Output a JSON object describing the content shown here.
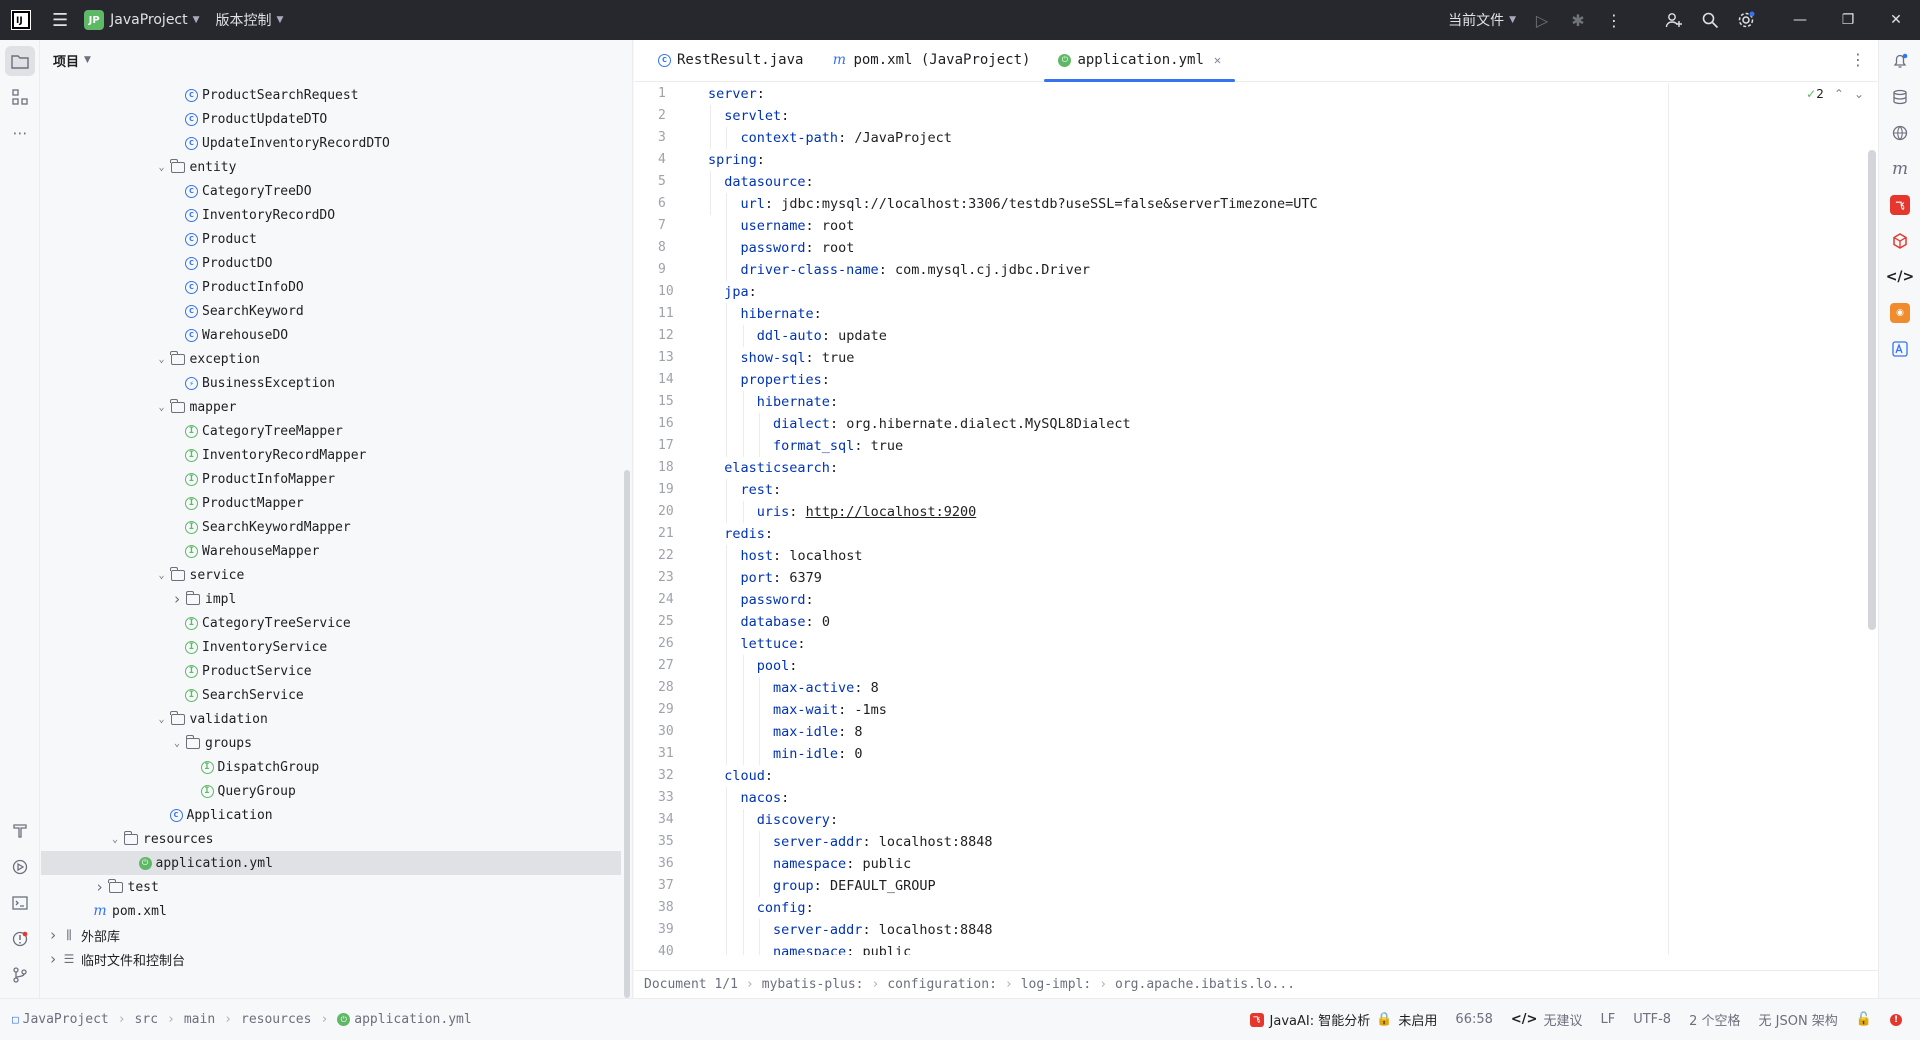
{
  "titlebar": {
    "project_badge": "JP",
    "project_name": "JavaProject",
    "vcs_label": "版本控制",
    "run_config": "当前文件"
  },
  "project_panel": {
    "title": "项目",
    "tree": [
      {
        "label": "ProductSearchRequest",
        "icon": "class-icon",
        "depth": 8,
        "chevron": ""
      },
      {
        "label": "ProductUpdateDTO",
        "icon": "class-icon",
        "depth": 8,
        "chevron": ""
      },
      {
        "label": "UpdateInventoryRecordDTO",
        "icon": "class-icon",
        "depth": 8,
        "chevron": ""
      },
      {
        "label": "entity",
        "icon": "folder-icon",
        "depth": 7,
        "chevron": "open"
      },
      {
        "label": "CategoryTreeDO",
        "icon": "class-icon",
        "depth": 8,
        "chevron": ""
      },
      {
        "label": "InventoryRecordDO",
        "icon": "class-icon",
        "depth": 8,
        "chevron": ""
      },
      {
        "label": "Product",
        "icon": "class-icon",
        "depth": 8,
        "chevron": ""
      },
      {
        "label": "ProductDO",
        "icon": "class-icon",
        "depth": 8,
        "chevron": ""
      },
      {
        "label": "ProductInfoDO",
        "icon": "class-icon",
        "depth": 8,
        "chevron": ""
      },
      {
        "label": "SearchKeyword",
        "icon": "class-icon",
        "depth": 8,
        "chevron": ""
      },
      {
        "label": "WarehouseDO",
        "icon": "class-icon",
        "depth": 8,
        "chevron": ""
      },
      {
        "label": "exception",
        "icon": "folder-icon",
        "depth": 7,
        "chevron": "open"
      },
      {
        "label": "BusinessException",
        "icon": "exception-class-icon",
        "depth": 8,
        "chevron": ""
      },
      {
        "label": "mapper",
        "icon": "folder-icon",
        "depth": 7,
        "chevron": "open"
      },
      {
        "label": "CategoryTreeMapper",
        "icon": "interface-icon",
        "depth": 8,
        "chevron": ""
      },
      {
        "label": "InventoryRecordMapper",
        "icon": "interface-icon",
        "depth": 8,
        "chevron": ""
      },
      {
        "label": "ProductInfoMapper",
        "icon": "interface-icon",
        "depth": 8,
        "chevron": ""
      },
      {
        "label": "ProductMapper",
        "icon": "interface-icon",
        "depth": 8,
        "chevron": ""
      },
      {
        "label": "SearchKeywordMapper",
        "icon": "interface-icon",
        "depth": 8,
        "chevron": ""
      },
      {
        "label": "WarehouseMapper",
        "icon": "interface-icon",
        "depth": 8,
        "chevron": ""
      },
      {
        "label": "service",
        "icon": "folder-icon",
        "depth": 7,
        "chevron": "open"
      },
      {
        "label": "impl",
        "icon": "folder-icon",
        "depth": 8,
        "chevron": "closed"
      },
      {
        "label": "CategoryTreeService",
        "icon": "interface-icon",
        "depth": 8,
        "chevron": ""
      },
      {
        "label": "InventoryService",
        "icon": "interface-icon",
        "depth": 8,
        "chevron": ""
      },
      {
        "label": "ProductService",
        "icon": "interface-icon",
        "depth": 8,
        "chevron": ""
      },
      {
        "label": "SearchService",
        "icon": "interface-icon",
        "depth": 8,
        "chevron": ""
      },
      {
        "label": "validation",
        "icon": "folder-icon",
        "depth": 7,
        "chevron": "open"
      },
      {
        "label": "groups",
        "icon": "folder-icon",
        "depth": 8,
        "chevron": "open"
      },
      {
        "label": "DispatchGroup",
        "icon": "interface-icon",
        "depth": 9,
        "chevron": ""
      },
      {
        "label": "QueryGroup",
        "icon": "interface-icon",
        "depth": 9,
        "chevron": ""
      },
      {
        "label": "Application",
        "icon": "spring-app-icon",
        "depth": 7,
        "chevron": ""
      },
      {
        "label": "resources",
        "icon": "folder-icon",
        "depth": 4,
        "chevron": "open"
      },
      {
        "label": "application.yml",
        "icon": "yaml-icon",
        "depth": 5,
        "chevron": "",
        "selected": true
      },
      {
        "label": "test",
        "icon": "folder-icon",
        "depth": 3,
        "chevron": "closed"
      },
      {
        "label": "pom.xml",
        "icon": "maven-icon",
        "depth": 2,
        "chevron": ""
      },
      {
        "label": "外部库",
        "icon": "library-icon",
        "depth": 0,
        "chevron": "closed"
      },
      {
        "label": "临时文件和控制台",
        "icon": "scratch-icon",
        "depth": 0,
        "chevron": "closed"
      }
    ]
  },
  "editor": {
    "tabs": [
      {
        "label": "RestResult.java",
        "icon": "class-icon",
        "closable": false
      },
      {
        "label": "pom.xml (JavaProject)",
        "icon": "maven-icon",
        "closable": false
      },
      {
        "label": "application.yml",
        "icon": "yaml-icon",
        "closable": true,
        "active": true
      }
    ],
    "inspection_count": "2",
    "lines": [
      {
        "n": "1",
        "indent": 0,
        "key": "server",
        "value": ""
      },
      {
        "n": "2",
        "indent": 1,
        "key": "servlet",
        "value": ""
      },
      {
        "n": "3",
        "indent": 2,
        "key": "context-path",
        "value": "/JavaProject"
      },
      {
        "n": "4",
        "indent": 0,
        "key": "spring",
        "value": ""
      },
      {
        "n": "5",
        "indent": 1,
        "key": "datasource",
        "value": ""
      },
      {
        "n": "6",
        "indent": 2,
        "key": "url",
        "value": "jdbc:mysql://localhost:3306/testdb?useSSL=false&serverTimezone=UTC"
      },
      {
        "n": "7",
        "indent": 2,
        "key": "username",
        "value": "root"
      },
      {
        "n": "8",
        "indent": 2,
        "key": "password",
        "value": "root"
      },
      {
        "n": "9",
        "indent": 2,
        "key": "driver-class-name",
        "value": "com.mysql.cj.jdbc.Driver"
      },
      {
        "n": "10",
        "indent": 1,
        "key": "jpa",
        "value": ""
      },
      {
        "n": "11",
        "indent": 2,
        "key": "hibernate",
        "value": ""
      },
      {
        "n": "12",
        "indent": 3,
        "key": "ddl-auto",
        "value": "update"
      },
      {
        "n": "13",
        "indent": 2,
        "key": "show-sql",
        "value": "true"
      },
      {
        "n": "14",
        "indent": 2,
        "key": "properties",
        "value": ""
      },
      {
        "n": "15",
        "indent": 3,
        "key": "hibernate",
        "value": ""
      },
      {
        "n": "16",
        "indent": 4,
        "key": "dialect",
        "value": "org.hibernate.dialect.MySQL8Dialect"
      },
      {
        "n": "17",
        "indent": 4,
        "key": "format_sql",
        "value": "true"
      },
      {
        "n": "18",
        "indent": 1,
        "key": "elasticsearch",
        "value": ""
      },
      {
        "n": "19",
        "indent": 2,
        "key": "rest",
        "value": ""
      },
      {
        "n": "20",
        "indent": 3,
        "key": "uris",
        "value": "http://localhost:9200",
        "url": true
      },
      {
        "n": "21",
        "indent": 1,
        "key": "redis",
        "value": ""
      },
      {
        "n": "22",
        "indent": 2,
        "key": "host",
        "value": "localhost"
      },
      {
        "n": "23",
        "indent": 2,
        "key": "port",
        "value": "6379"
      },
      {
        "n": "24",
        "indent": 2,
        "key": "password",
        "value": ""
      },
      {
        "n": "25",
        "indent": 2,
        "key": "database",
        "value": "0"
      },
      {
        "n": "26",
        "indent": 2,
        "key": "lettuce",
        "value": ""
      },
      {
        "n": "27",
        "indent": 3,
        "key": "pool",
        "value": ""
      },
      {
        "n": "28",
        "indent": 4,
        "key": "max-active",
        "value": "8"
      },
      {
        "n": "29",
        "indent": 4,
        "key": "max-wait",
        "value": "-1ms"
      },
      {
        "n": "30",
        "indent": 4,
        "key": "max-idle",
        "value": "8"
      },
      {
        "n": "31",
        "indent": 4,
        "key": "min-idle",
        "value": "0"
      },
      {
        "n": "32",
        "indent": 1,
        "key": "cloud",
        "value": ""
      },
      {
        "n": "33",
        "indent": 2,
        "key": "nacos",
        "value": ""
      },
      {
        "n": "34",
        "indent": 3,
        "key": "discovery",
        "value": ""
      },
      {
        "n": "35",
        "indent": 4,
        "key": "server-addr",
        "value": "localhost:8848"
      },
      {
        "n": "36",
        "indent": 4,
        "key": "namespace",
        "value": "public"
      },
      {
        "n": "37",
        "indent": 4,
        "key": "group",
        "value": "DEFAULT_GROUP"
      },
      {
        "n": "38",
        "indent": 3,
        "key": "config",
        "value": ""
      },
      {
        "n": "39",
        "indent": 4,
        "key": "server-addr",
        "value": "localhost:8848"
      },
      {
        "n": "40",
        "indent": 4,
        "key": "namespace",
        "value": "public"
      }
    ],
    "breadcrumb": [
      "Document 1/1",
      "mybatis-plus:",
      "configuration:",
      "log-impl:",
      "org.apache.ibatis.lo..."
    ]
  },
  "statusbar": {
    "path": [
      "JavaProject",
      "src",
      "main",
      "resources",
      "application.yml"
    ],
    "ai_label": "JavaAI: 智能分析",
    "ai_status": "未启用",
    "position": "66:58",
    "suggestion": "无建议",
    "line_sep": "LF",
    "encoding": "UTF-8",
    "indent": "2 个空格",
    "schema": "无 JSON 架构"
  },
  "colors": {
    "accent": "#3574f0",
    "yaml_key": "#0033b3",
    "green": "#5fb865",
    "error": "#e5372d"
  }
}
